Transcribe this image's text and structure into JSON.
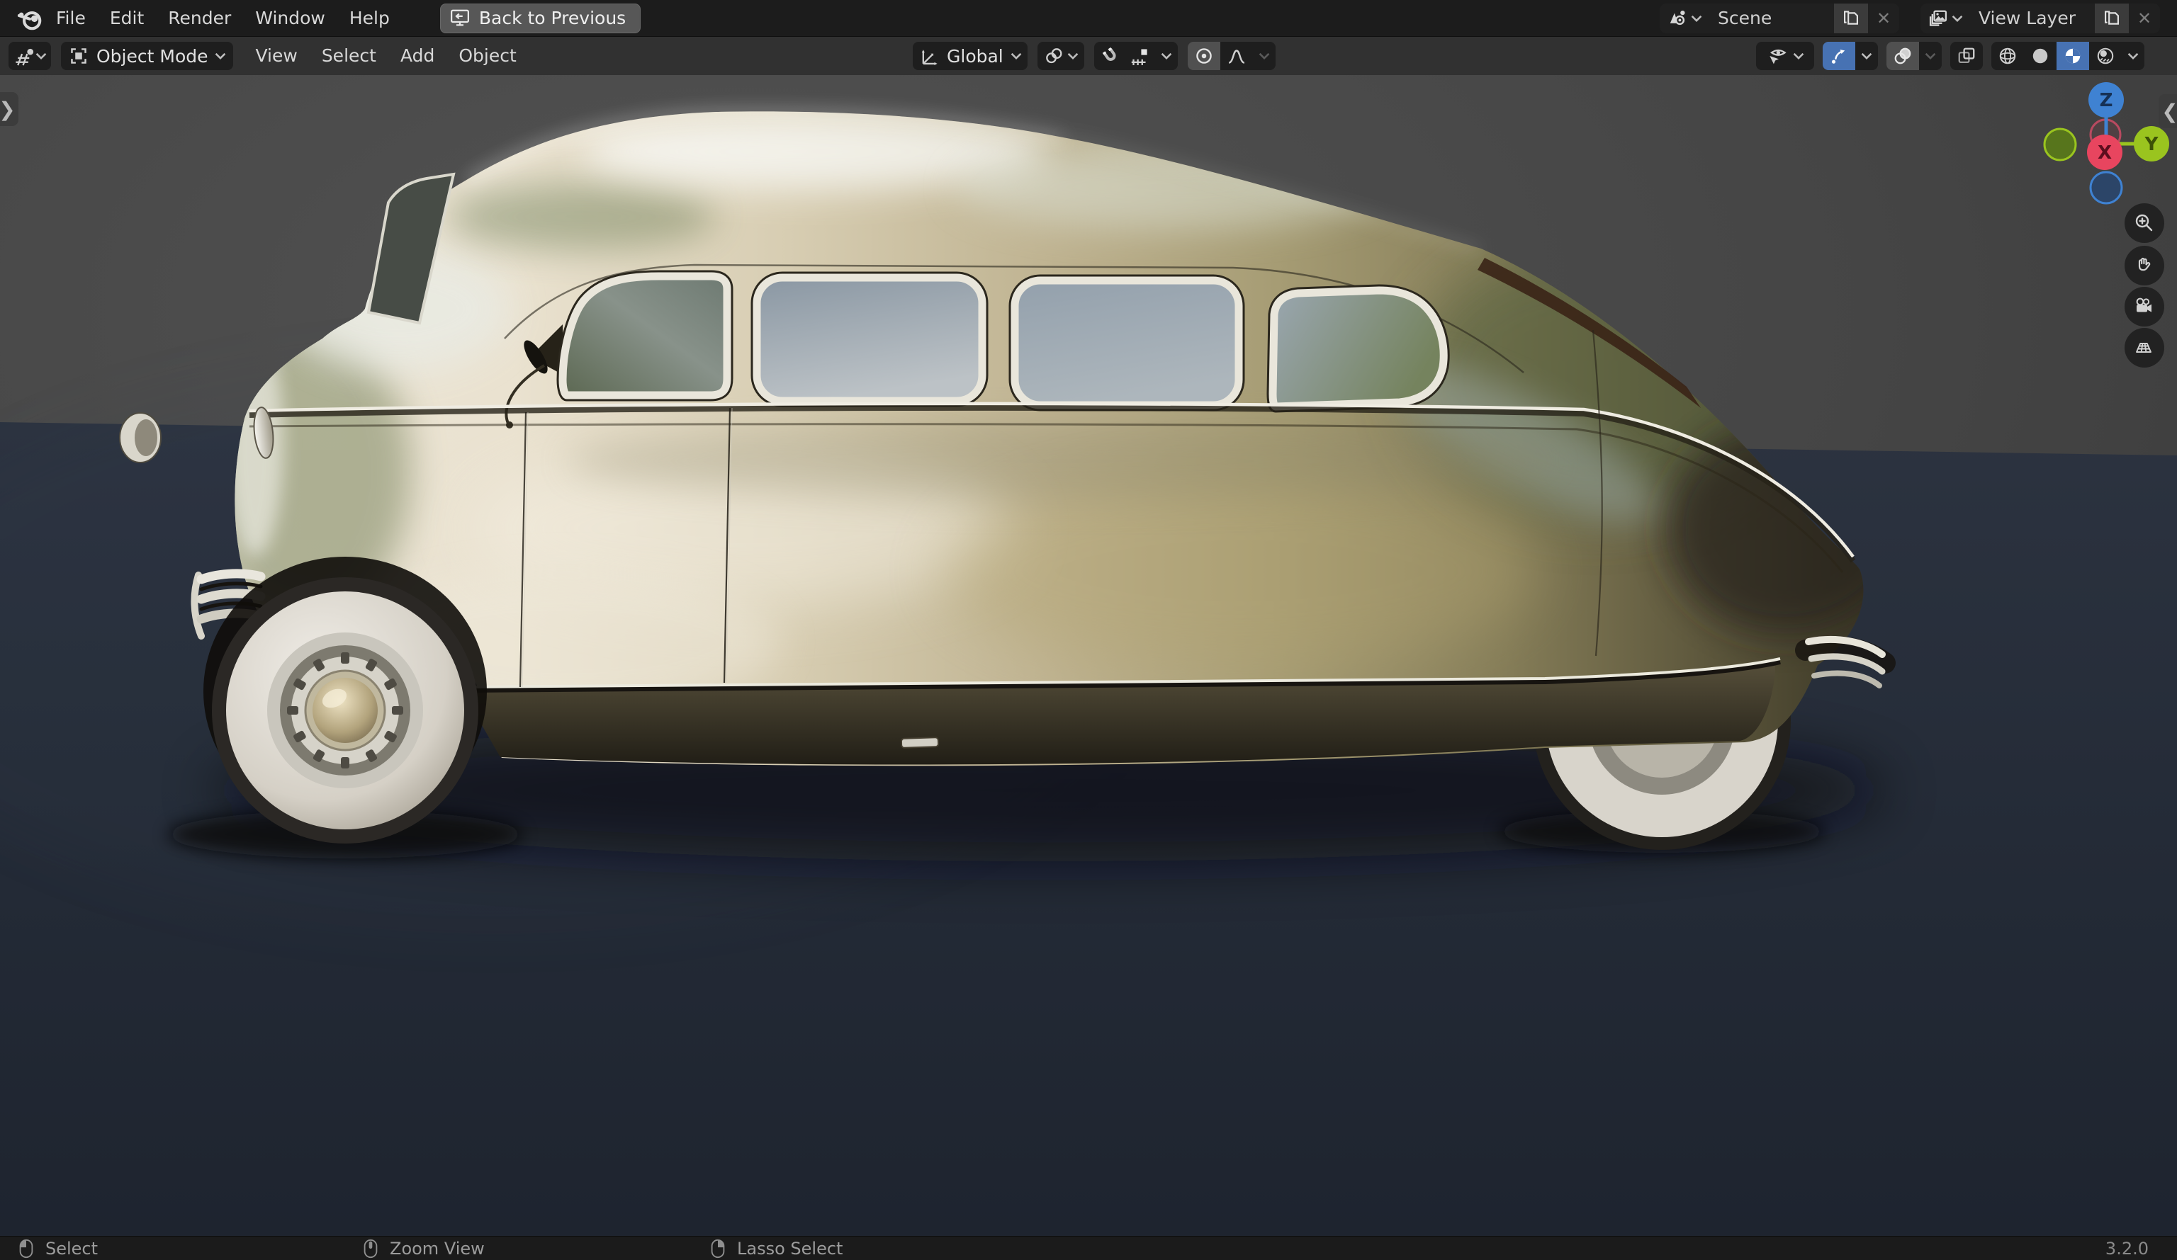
{
  "app": {
    "menus": [
      "File",
      "Edit",
      "Render",
      "Window",
      "Help"
    ],
    "back_button_label": "Back to Previous",
    "scene_selector": {
      "value": "Scene"
    },
    "view_layer_selector": {
      "value": "View Layer"
    }
  },
  "viewport_header": {
    "mode_selector": "Object Mode",
    "menus": [
      "View",
      "Select",
      "Add",
      "Object"
    ],
    "orientation_selector": "Global"
  },
  "nav_gizmo": {
    "z": "Z",
    "y": "Y",
    "x": "X"
  },
  "statusbar": {
    "left_click": "Select",
    "middle_click": "Zoom View",
    "right_click": "Lasso Select",
    "version": "3.2.0"
  },
  "glyphs": {
    "close": "✕",
    "collapse_right_panel": "❮",
    "collapse_left_panel": "❯"
  },
  "colors": {
    "accent_blue": "#4772b3",
    "axis_x": "#e8455f",
    "axis_y": "#9ac41f",
    "axis_z": "#3f82d2",
    "backdrop_gray": "#464646",
    "floor_navy": "#232a36",
    "car_body_champagne": "#cfc5a6",
    "whitewall": "#ddd9d0"
  }
}
